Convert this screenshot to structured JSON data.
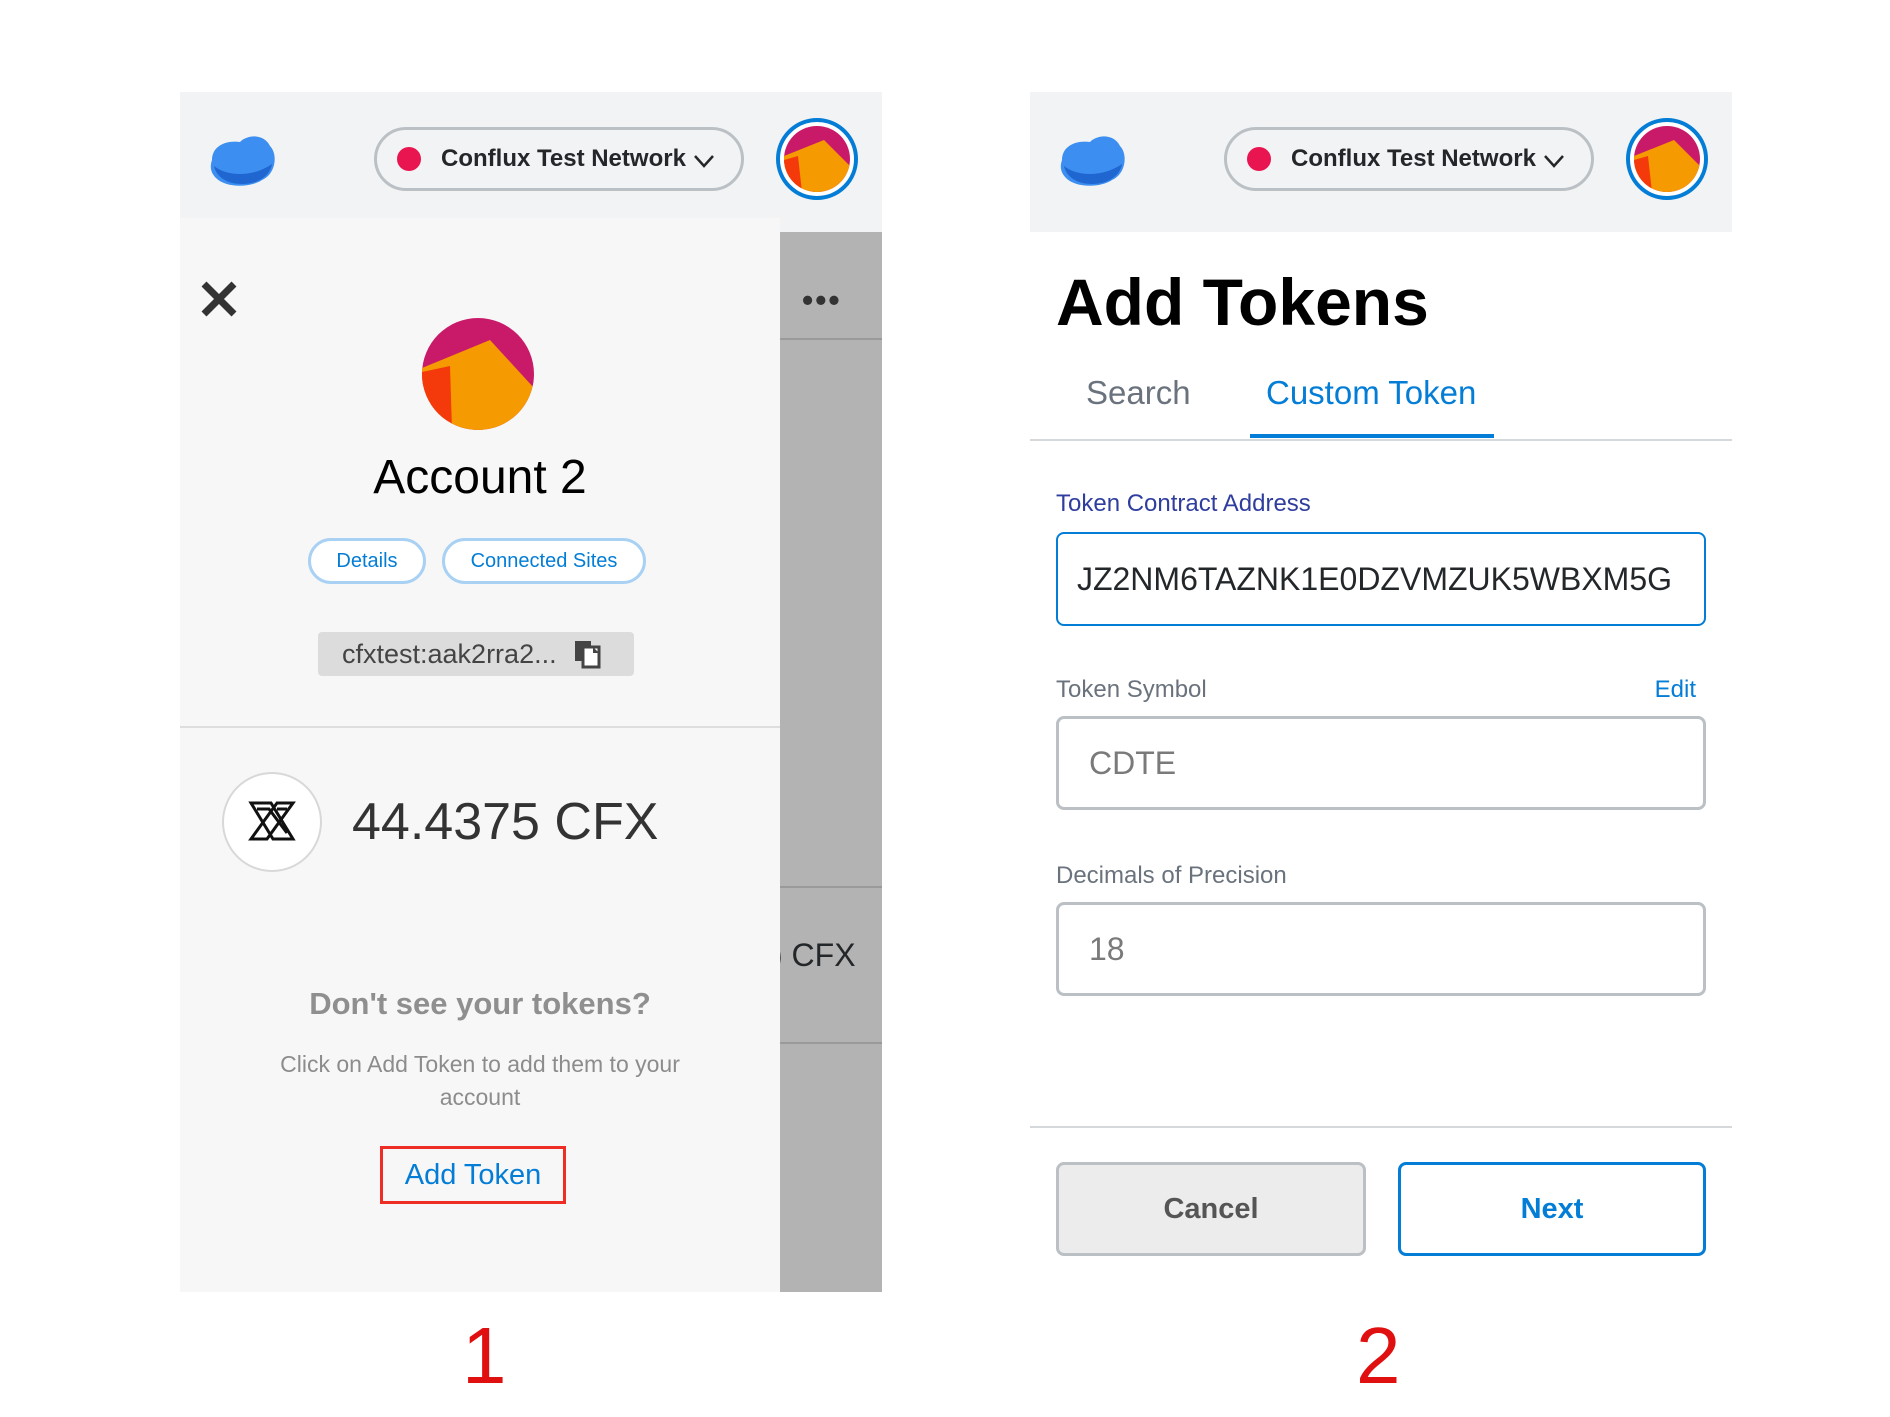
{
  "panel1": {
    "network": {
      "name": "Conflux Test Network",
      "dot_color": "#e91550"
    },
    "menu_icon": "more-horizontal-icon",
    "close_icon": "close-icon",
    "account": {
      "name": "Account 2",
      "details_label": "Details",
      "connected_sites_label": "Connected Sites",
      "address": "cfxtest:aak2rra2...",
      "copy_icon": "copy-icon"
    },
    "balance": "44.4375 CFX",
    "background_balance_peek": ") CFX",
    "empty_state": {
      "heading": "Don't see your tokens?",
      "description": "Click on Add Token to add them to your account",
      "add_token_label": "Add Token"
    },
    "step_label": "1"
  },
  "panel2": {
    "network": {
      "name": "Conflux Test Network",
      "dot_color": "#e91550"
    },
    "title": "Add Tokens",
    "tabs": [
      {
        "label": "Search",
        "active": false
      },
      {
        "label": "Custom Token",
        "active": true
      }
    ],
    "form": {
      "contract_address_label": "Token Contract Address",
      "contract_address_value": "JZ2NM6TAZNK1E0DZVMZUK5WBXM5G",
      "symbol_label": "Token Symbol",
      "symbol_edit_label": "Edit",
      "symbol_value": "CDTE",
      "decimals_label": "Decimals of Precision",
      "decimals_value": "18"
    },
    "cancel_label": "Cancel",
    "next_label": "Next",
    "step_label": "2"
  },
  "colors": {
    "accent": "#037dd6",
    "highlight_box": "#ee2e24",
    "step_number": "#e01010"
  }
}
